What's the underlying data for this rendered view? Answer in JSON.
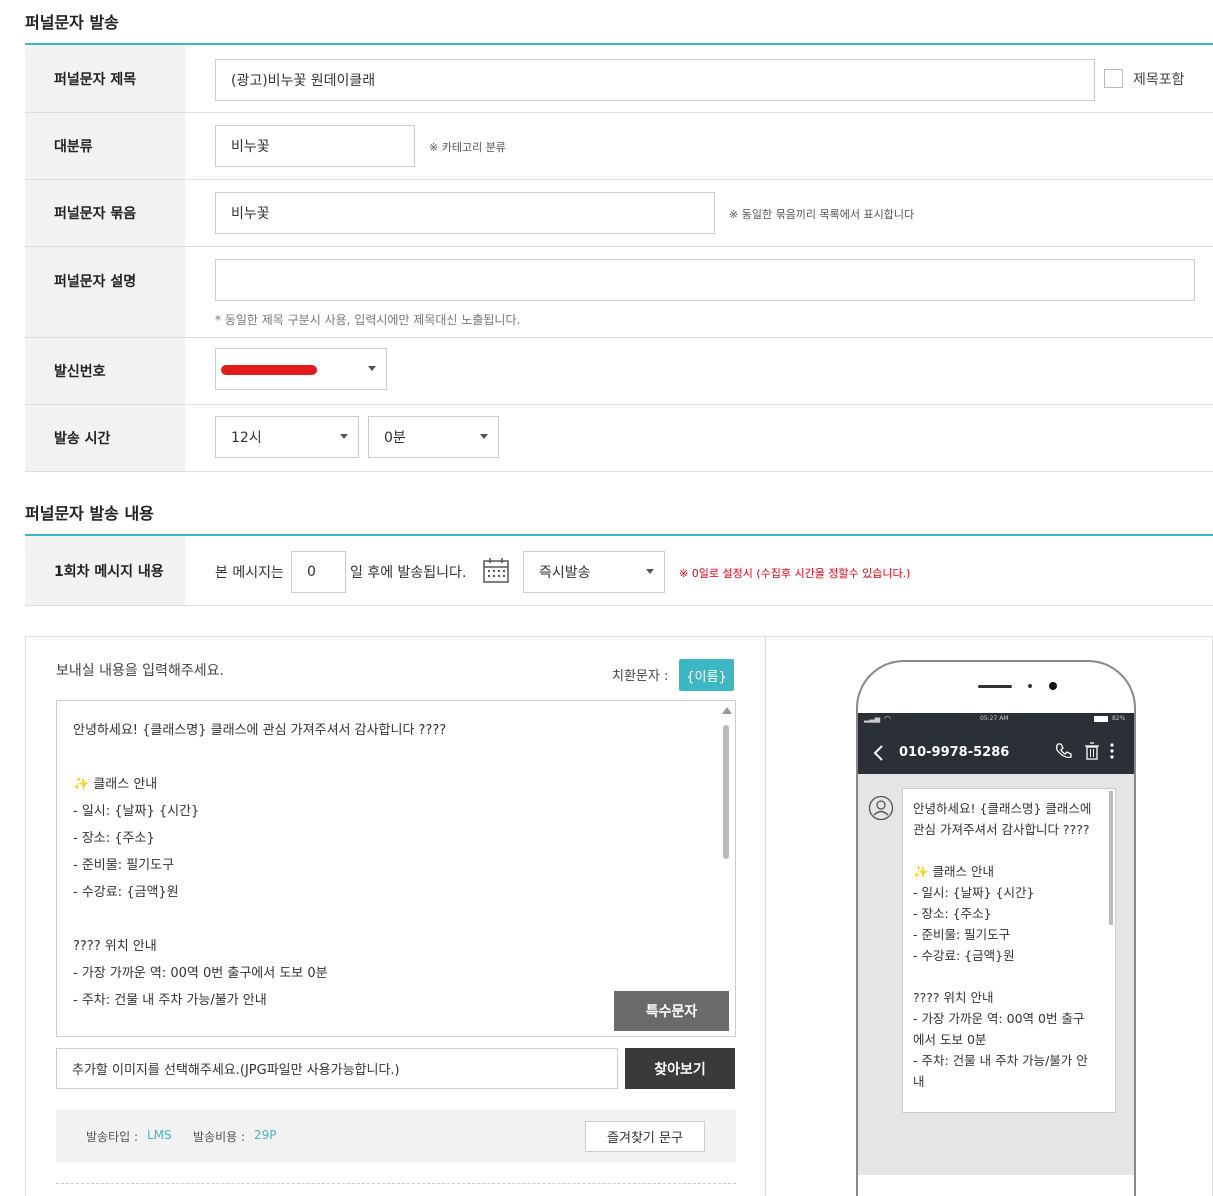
{
  "section1": {
    "title": "퍼널문자 발송"
  },
  "form": {
    "subject": {
      "label": "퍼널문자 제목",
      "value": "(광고)비누꽃 원데이클래",
      "checkbox_label": "제목포함"
    },
    "category": {
      "label": "대분류",
      "value": "비누꽃",
      "note": "※ 카테고리 분류"
    },
    "group": {
      "label": "퍼널문자 묶음",
      "value": "비누꽃",
      "note": "※ 동일한 묶음끼리 목록에서 표시합니다"
    },
    "description": {
      "label": "퍼널문자 설명",
      "value": "",
      "note": "* 동일한 제목 구분시 사용, 입력시에만 제목대신 노출됩니다."
    },
    "sender": {
      "label": "발신번호",
      "redacted": true
    },
    "send_time": {
      "label": "발송 시간",
      "hour": "12시",
      "minute": "0분"
    }
  },
  "section2": {
    "title": "퍼널문자 발송 내용"
  },
  "round1": {
    "label": "1회차 메시지 내용",
    "prefix": "본 메시지는",
    "days": "0",
    "suffix": "일 후에 발송됩니다.",
    "mode": "즉시발송",
    "warning": "※ 0일로 설정시 (수집후 시간을 정할수 있습니다.)"
  },
  "editor": {
    "prompt": "보내실 내용을 입력해주세요.",
    "replace_label": "치환문자 :",
    "replace_token": "{이름}",
    "message_lines": [
      "안녕하세요! {클래스명} 클래스에 관심 가져주셔서 감사합니다 ????",
      "",
      "✨ 클래스 안내",
      "- 일시: {날짜} {시간}",
      "- 장소: {주소}",
      "- 준비물: 필기도구",
      "- 수강료: {금액}원",
      "",
      "???? 위치 안내",
      "- 가장 가까운 역: 00역 0번 출구에서 도보 0분",
      "- 주차: 건물 내 주차 가능/불가 안내"
    ],
    "special_chars_button": "특수문자",
    "image_placeholder": "추가할 이미지를 선택해주세요.(JPG파일만 사용가능합니다.)",
    "browse_button": "찾아보기",
    "send_type_label": "발송타입 :",
    "send_type_value": "LMS",
    "cost_label": "발송비용 :",
    "cost_value": "29P",
    "favorites_button": "즐겨찾기 문구"
  },
  "phone": {
    "status_time": "05:27 AM",
    "battery": "82%",
    "contact": "010-9978-5286",
    "bubble_lines": [
      "안녕하세요! {클래스명} 클래스에",
      "관심 가져주셔서 감사합니다 ????",
      "",
      "✨ 클래스 안내",
      "- 일시: {날짜} {시간}",
      "- 장소: {주소}",
      "- 준비물: 필기도구",
      "- 수강료: {금액}원",
      "",
      "???? 위치 안내",
      "- 가장 가까운 역: 00역 0번 출구",
      "에서 도보 0분",
      "- 주차: 건물 내 주차 가능/불가 안",
      "내"
    ]
  },
  "colors": {
    "accent": "#3bb8c3",
    "warning": "#e60012",
    "header_dark": "#2b2f36"
  }
}
